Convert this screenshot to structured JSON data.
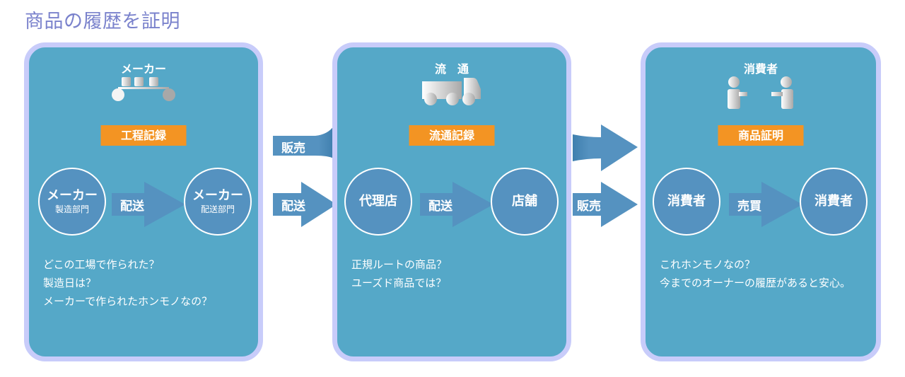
{
  "title": "商品の履歴を証明",
  "colors": {
    "panel_fill": "#55a8c8",
    "panel_border": "#c8ccfa",
    "node_fill": "#5592c0",
    "arrow_fill": "#5592c0",
    "badge_fill": "#f39423",
    "title_color": "#7a82cc"
  },
  "panels": [
    {
      "header": "メーカー",
      "icon": "conveyor-belt-icon",
      "badge": "工程記録",
      "nodes": [
        {
          "main": "メーカー",
          "sub": "製造部門"
        },
        {
          "main": "メーカー",
          "sub": "配送部門"
        }
      ],
      "arrow": "配送",
      "questions": [
        "どこの工場で作られた？",
        "製造日は？",
        "メーカーで作られたホンモノなの？"
      ]
    },
    {
      "header": "流　通",
      "icon": "truck-icon",
      "badge": "流通記録",
      "nodes": [
        {
          "main": "代理店",
          "sub": ""
        },
        {
          "main": "店舗",
          "sub": ""
        }
      ],
      "arrow": "配送",
      "questions": [
        "正規ルートの商品？",
        "ユーズド商品では？"
      ]
    },
    {
      "header": "消費者",
      "icon": "people-handshake-icon",
      "badge": "商品証明",
      "nodes": [
        {
          "main": "消費者",
          "sub": ""
        },
        {
          "main": "消費者",
          "sub": ""
        }
      ],
      "arrow": "売買",
      "questions": [
        "これホンモノなの？",
        "今までのオーナーの履歴があると安心。"
      ]
    }
  ],
  "connectors": {
    "maker_to_distribution_top": "販売",
    "maker_to_distribution_bottom": "配送",
    "distribution_to_consumer_top": "",
    "distribution_to_consumer_bottom": "販売"
  }
}
